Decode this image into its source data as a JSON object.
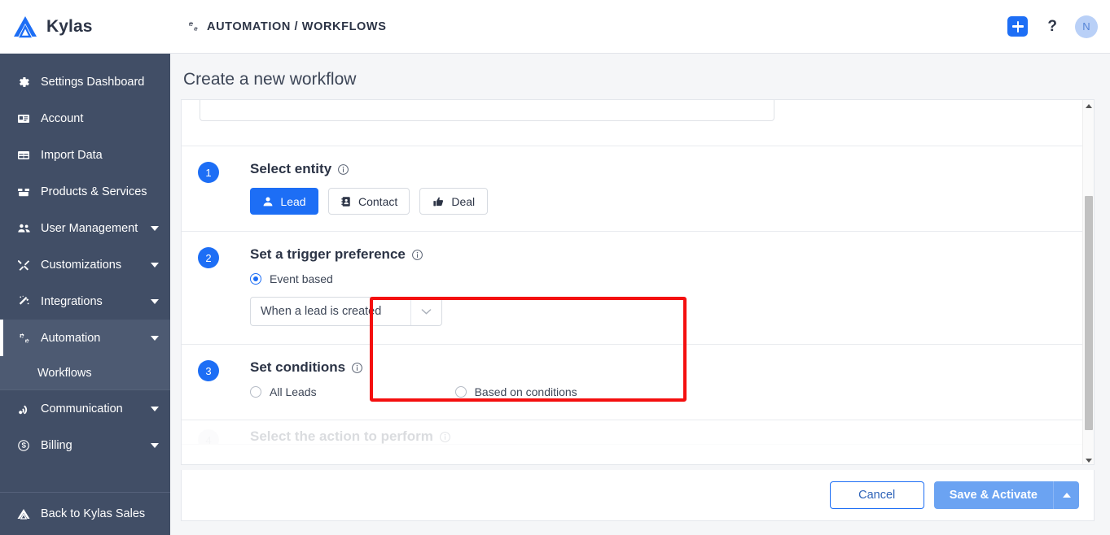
{
  "brand": {
    "name": "Kylas",
    "logo_icon": "kylas-mountain-logo"
  },
  "sidebar": {
    "items": [
      {
        "label": "Settings Dashboard",
        "icon": "gear-icon",
        "has_caret": false
      },
      {
        "label": "Account",
        "icon": "id-card-icon",
        "has_caret": false
      },
      {
        "label": "Import Data",
        "icon": "table-icon",
        "has_caret": false
      },
      {
        "label": "Products & Services",
        "icon": "box-icon",
        "has_caret": false
      },
      {
        "label": "User Management",
        "icon": "users-icon",
        "has_caret": true
      },
      {
        "label": "Customizations",
        "icon": "tools-icon",
        "has_caret": true
      },
      {
        "label": "Integrations",
        "icon": "magic-wand-icon",
        "has_caret": true
      },
      {
        "label": "Automation",
        "icon": "cogs-icon",
        "has_caret": true,
        "active": true
      }
    ],
    "sub_items": [
      {
        "label": "Workflows",
        "parent": "Automation"
      }
    ],
    "items_after": [
      {
        "label": "Communication",
        "icon": "broadcast-icon",
        "has_caret": true
      },
      {
        "label": "Billing",
        "icon": "dollar-circle-icon",
        "has_caret": true
      }
    ],
    "bottom": {
      "label": "Back to Kylas Sales",
      "icon": "kylas-mountain-icon"
    }
  },
  "topbar": {
    "breadcrumb": "AUTOMATION / WORKFLOWS",
    "breadcrumb_icon": "cogs-icon",
    "add_button_icon": "plus-icon",
    "help_button_label": "?",
    "avatar_initial": "N"
  },
  "page": {
    "title": "Create a new workflow",
    "name_input_value": "",
    "sections": [
      {
        "number": "1",
        "title": "Select entity",
        "info_icon": "info-circle-icon",
        "entities": [
          {
            "label": "Lead",
            "icon": "person-icon",
            "selected": true
          },
          {
            "label": "Contact",
            "icon": "address-book-icon",
            "selected": false
          },
          {
            "label": "Deal",
            "icon": "thumbs-up-icon",
            "selected": false
          }
        ]
      },
      {
        "number": "2",
        "title": "Set a trigger preference",
        "info_icon": "info-circle-icon",
        "radio": {
          "label": "Event based",
          "checked": true
        },
        "select": {
          "value": "When a lead is created",
          "caret_icon": "chevron-down-icon"
        },
        "highlighted": true
      },
      {
        "number": "3",
        "title": "Set conditions",
        "info_icon": "info-circle-icon",
        "options": [
          {
            "label": "All Leads",
            "checked": false
          },
          {
            "label": "Based on conditions",
            "checked": false
          }
        ]
      },
      {
        "number": "4",
        "title": "Select the action to perform",
        "info_icon": "info-circle-icon",
        "partially_visible": true
      }
    ]
  },
  "footer": {
    "cancel_label": "Cancel",
    "save_label": "Save & Activate",
    "save_caret_icon": "chevron-up-icon"
  },
  "scrollbar": {
    "up_arrow_icon": "triangle-up-icon",
    "down_arrow_icon": "triangle-down-icon"
  },
  "colors": {
    "sidebar_bg": "#414e66",
    "sidebar_active": "#4d5a72",
    "accent_blue": "#1d6ef5",
    "save_button_blue": "#6ba3f2",
    "highlight_red": "#f40f0f",
    "page_bg": "#f5f6f8"
  }
}
